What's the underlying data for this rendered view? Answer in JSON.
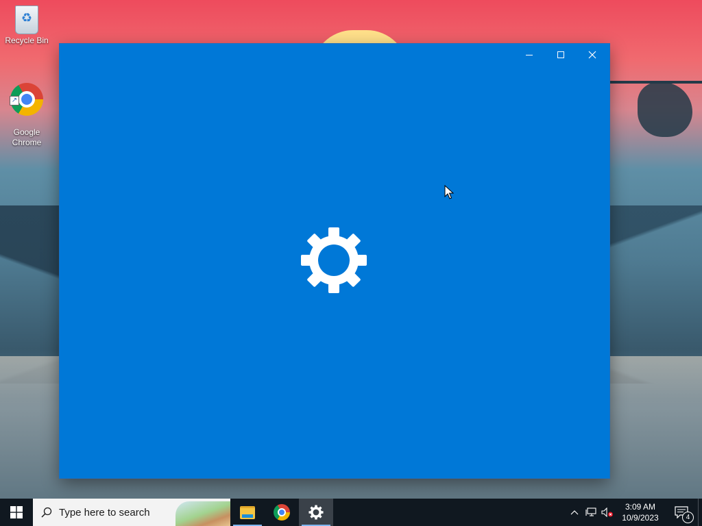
{
  "desktop": {
    "icons": [
      {
        "label": "Recycle Bin",
        "icon": "recycle-bin-icon"
      },
      {
        "label": "Google\nChrome",
        "icon": "chrome-icon"
      }
    ]
  },
  "window": {
    "title": "",
    "background_color": "#0078d7",
    "splash_icon": "settings-gear-icon",
    "controls": {
      "minimize": "minimize-icon",
      "maximize": "maximize-icon",
      "close": "close-icon"
    }
  },
  "taskbar": {
    "search": {
      "placeholder": "Type here to search"
    },
    "apps": [
      {
        "name": "File Explorer",
        "icon": "file-explorer-icon",
        "active": false
      },
      {
        "name": "Google Chrome",
        "icon": "chrome-icon",
        "active": false
      },
      {
        "name": "Settings",
        "icon": "settings-gear-icon",
        "active": true
      }
    ],
    "tray": {
      "clock_time": "3:09 AM",
      "clock_date": "10/9/2023",
      "notification_count": "4"
    }
  }
}
